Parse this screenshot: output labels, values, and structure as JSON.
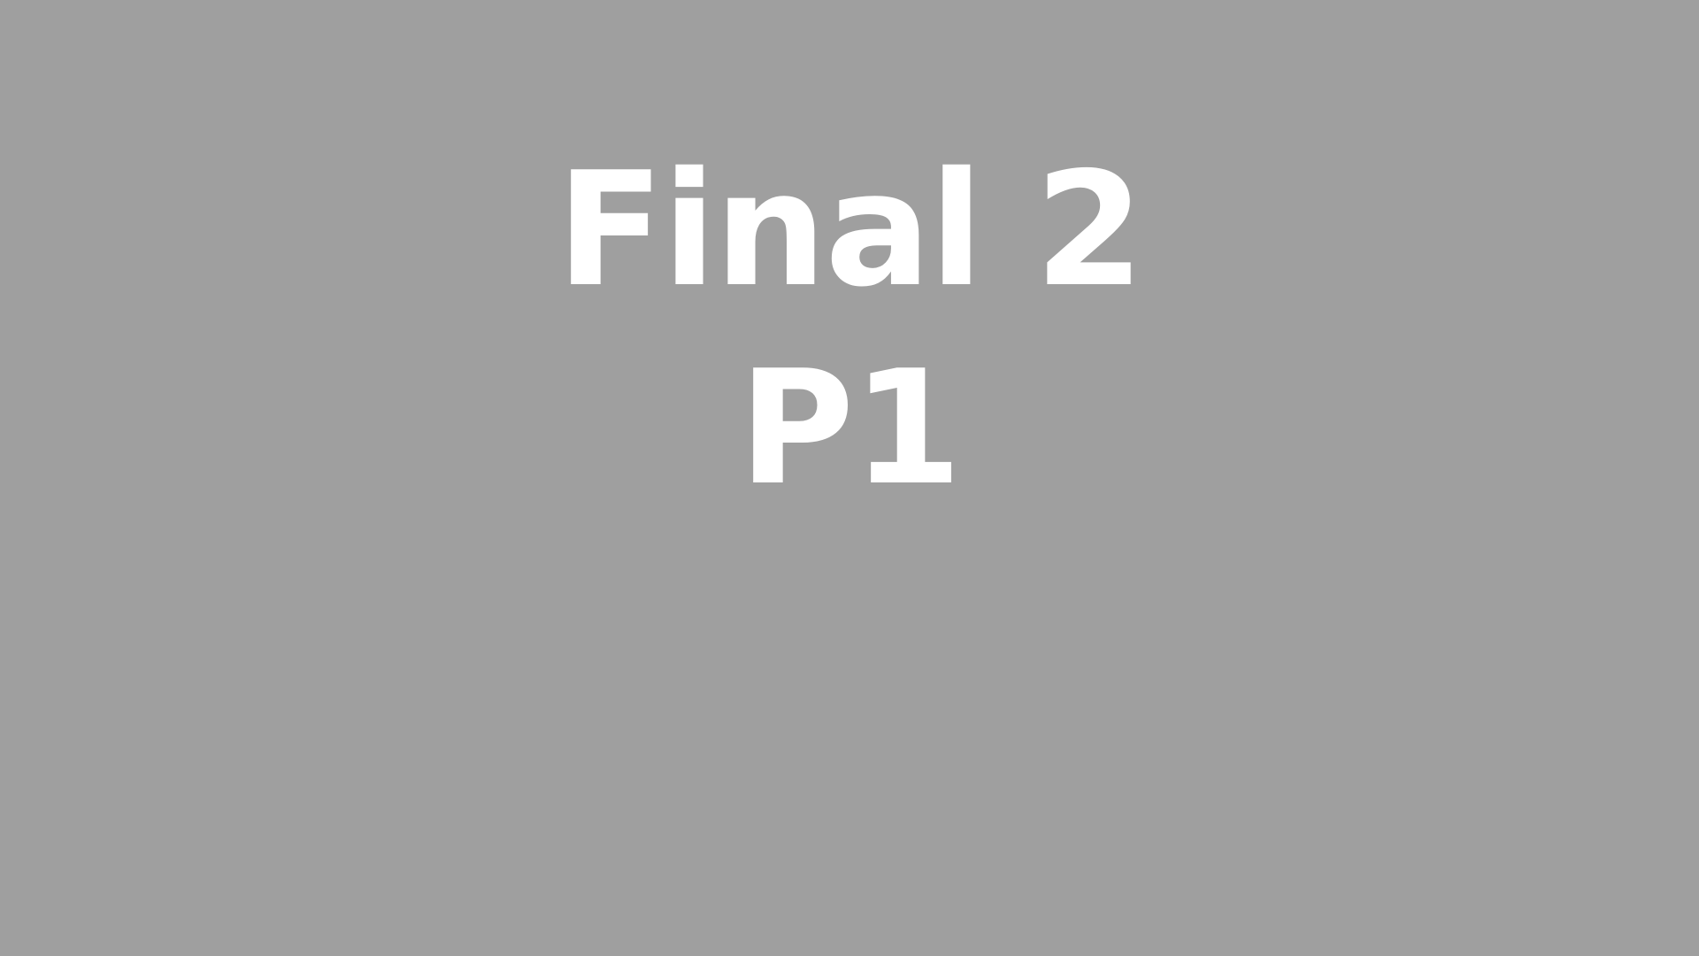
{
  "screen": {
    "background_color": "#9f9f9f",
    "text_color": "#ffffff",
    "line1": "Final 2",
    "line2": "P1"
  }
}
